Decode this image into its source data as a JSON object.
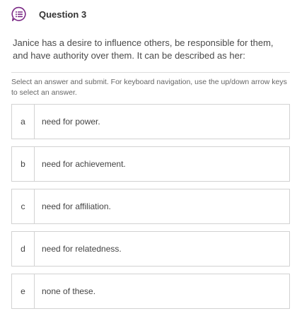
{
  "header": {
    "icon": "question-list-icon",
    "accent_color": "#7b2a86",
    "title": "Question 3"
  },
  "question": {
    "text": "Janice has a desire to influence others, be responsible for them, and have authority over them. It can be described as her:"
  },
  "instructions": {
    "text": "Select an answer and submit. For keyboard navigation, use the up/down arrow keys to select an answer."
  },
  "answers": [
    {
      "letter": "a",
      "text": "need for power."
    },
    {
      "letter": "b",
      "text": "need for achievement."
    },
    {
      "letter": "c",
      "text": "need for affiliation."
    },
    {
      "letter": "d",
      "text": "need for relatedness."
    },
    {
      "letter": "e",
      "text": "none of these."
    }
  ]
}
